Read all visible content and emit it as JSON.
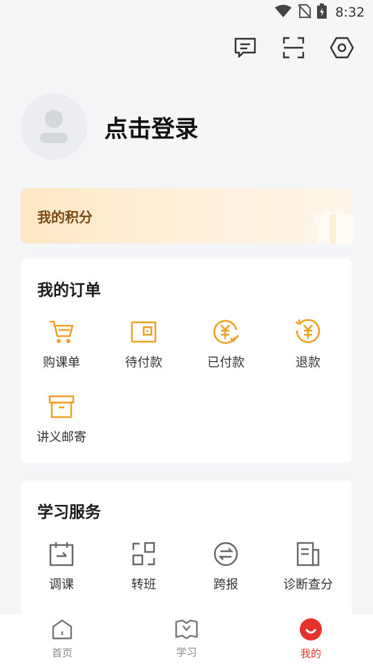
{
  "status_bar": {
    "time": "8:32"
  },
  "profile": {
    "login_text": "点击登录"
  },
  "points": {
    "label": "我的积分"
  },
  "orders": {
    "title": "我的订单",
    "items": [
      {
        "label": "购课单",
        "icon": "cart-icon"
      },
      {
        "label": "待付款",
        "icon": "wallet-icon"
      },
      {
        "label": "已付款",
        "icon": "paid-icon"
      },
      {
        "label": "退款",
        "icon": "refund-icon"
      },
      {
        "label": "讲义邮寄",
        "icon": "box-icon"
      }
    ]
  },
  "services": {
    "title": "学习服务",
    "items": [
      {
        "label": "调课",
        "icon": "calendar-icon"
      },
      {
        "label": "转班",
        "icon": "transfer-icon"
      },
      {
        "label": "跨报",
        "icon": "exchange-icon"
      },
      {
        "label": "诊断查分",
        "icon": "report-icon"
      }
    ]
  },
  "tabs": [
    {
      "label": "首页",
      "icon": "home-icon"
    },
    {
      "label": "学习",
      "icon": "book-icon"
    },
    {
      "label": "我的",
      "icon": "mine-icon",
      "active": true
    }
  ],
  "colors": {
    "accent_orange": "#f0a020",
    "accent_red": "#e5322d"
  }
}
